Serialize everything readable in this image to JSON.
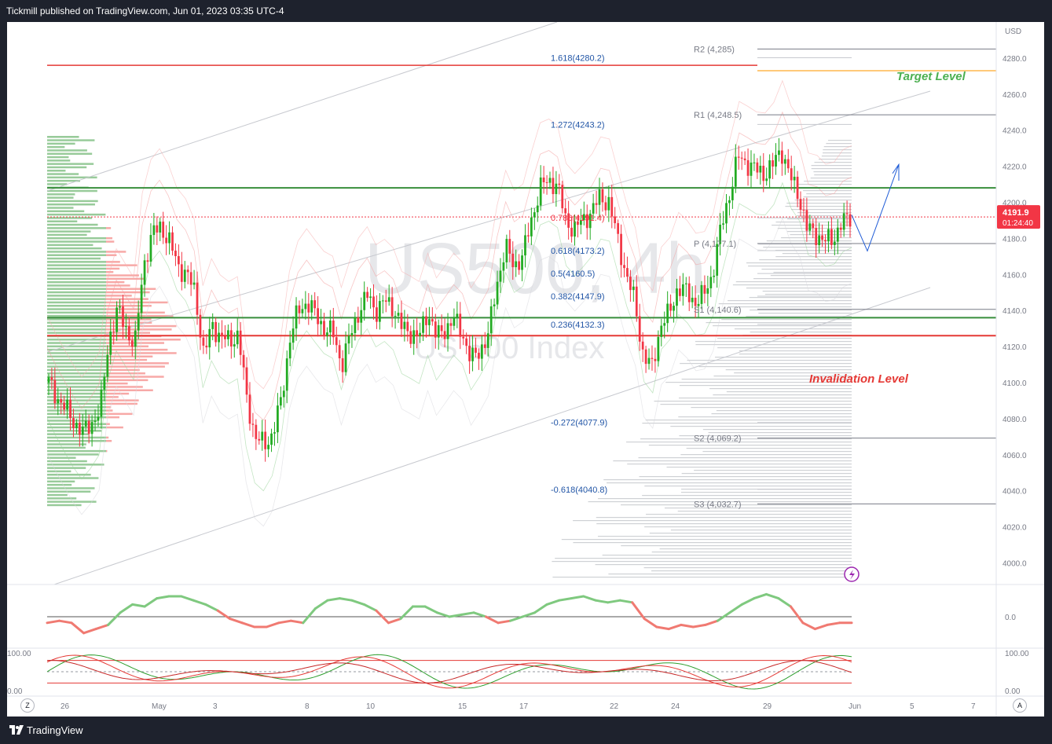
{
  "header": {
    "published": "Tickmill published on TradingView.com, Jun 01, 2023 03:35 UTC-4"
  },
  "footer": {
    "brand": "TradingView",
    "logo_icon": "tradingview-logo-icon"
  },
  "buttons": {
    "left_corner": "Z",
    "right_corner": "A"
  },
  "colors": {
    "up": "#22ab22",
    "down": "#f23645",
    "fib_text": "#2155a6",
    "green_line": "#388e3c",
    "red_line": "#e53935",
    "target_text": "#4caf50",
    "invalid_text": "#e53935",
    "pivot_text": "#787b86",
    "orange": "#ffb74d",
    "forecast": "#1e5bd6",
    "price_badge": "#f23645"
  },
  "chart_data": [
    {
      "type": "candlestick",
      "title": "",
      "watermark": {
        "symbol": "US500, 4h",
        "name": "US 500 Index"
      },
      "currency": "USD",
      "ylim": [
        3988,
        4300
      ],
      "y_ticks": [
        "4280.0",
        "4260.0",
        "4240.0",
        "4220.0",
        "4200.0",
        "4180.0",
        "4160.0",
        "4140.0",
        "4120.0",
        "4100.0",
        "4080.0",
        "4060.0",
        "4040.0",
        "4020.0",
        "4000.0"
      ],
      "x_ticks": [
        "26",
        "May",
        "3",
        "8",
        "10",
        "15",
        "17",
        "22",
        "24",
        "29",
        "Jun",
        "5",
        "7"
      ],
      "close_path": [
        4100,
        4092,
        4085,
        4078,
        4072,
        4078,
        4085,
        4125,
        4140,
        4130,
        4120,
        4165,
        4182,
        4187,
        4178,
        4165,
        4160,
        4150,
        4115,
        4132,
        4125,
        4123,
        4127,
        4090,
        4070,
        4065,
        4072,
        4090,
        4125,
        4140,
        4145,
        4137,
        4130,
        4127,
        4110,
        4126,
        4140,
        4148,
        4140,
        4145,
        4142,
        4130,
        4128,
        4125,
        4140,
        4125,
        4130,
        4135,
        4128,
        4112,
        4118,
        4126,
        4155,
        4175,
        4165,
        4170,
        4190,
        4208,
        4212,
        4210,
        4190,
        4185,
        4190,
        4195,
        4203,
        4200,
        4180,
        4160,
        4145,
        4115,
        4108,
        4132,
        4138,
        4153,
        4150,
        4145,
        4148,
        4160,
        4185,
        4205,
        4225,
        4222,
        4218,
        4216,
        4220,
        4230,
        4214,
        4205,
        4185,
        4183,
        4178,
        4180,
        4188,
        4191.9
      ],
      "close_path_extent": {
        "first_date": "26",
        "last_date": "Jun"
      },
      "last_price": "4191.9",
      "countdown": "01:24:40",
      "fib_levels": [
        {
          "label": "1.618(4280.2)",
          "value": 4280.2
        },
        {
          "label": "1.272(4243.2)",
          "value": 4243.2
        },
        {
          "label": "0.786(4191.4)",
          "value": 4191.4
        },
        {
          "label": "0.618(4173.2)",
          "value": 4173.2
        },
        {
          "label": "0.5(4160.5)",
          "value": 4160.5
        },
        {
          "label": "0.382(4147.9)",
          "value": 4147.9
        },
        {
          "label": "0.236(4132.3)",
          "value": 4132.3
        },
        {
          "label": "-0.272(4077.9)",
          "value": 4077.9
        },
        {
          "label": "-0.618(4040.8)",
          "value": 4040.8
        }
      ],
      "pivots": [
        {
          "label": "R2 (4,285)",
          "value": 4285
        },
        {
          "label": "R1 (4,248.5)",
          "value": 4248.5
        },
        {
          "label": "P (4,177.1)",
          "value": 4177.1
        },
        {
          "label": "S1 (4,140.6)",
          "value": 4140.6
        },
        {
          "label": "S2 (4,069.2)",
          "value": 4069.2
        },
        {
          "label": "S3 (4,032.7)",
          "value": 4032.7
        }
      ],
      "horizontal_lines": [
        {
          "name": "red-resistance",
          "value": 4276,
          "color": "#e53935"
        },
        {
          "name": "target",
          "value": 4273,
          "color": "#ffb74d"
        },
        {
          "name": "green-upper",
          "value": 4208,
          "color": "#388e3c"
        },
        {
          "name": "green-lower",
          "value": 4136,
          "color": "#388e3c"
        },
        {
          "name": "invalidation",
          "value": 4126,
          "color": "#e53935"
        }
      ],
      "annotations": {
        "target": "Target Level",
        "invalidation": "Invalidation Level"
      }
    },
    {
      "type": "line",
      "name": "oscillator",
      "y_ticks": [
        "0.0"
      ],
      "zero_line": 0,
      "ylim": [
        -1.2,
        1.2
      ],
      "values": [
        -0.3,
        -0.2,
        -0.3,
        -0.8,
        -0.6,
        -0.4,
        0.2,
        0.6,
        0.5,
        0.9,
        1.0,
        1.0,
        0.8,
        0.6,
        0.3,
        -0.1,
        -0.3,
        -0.5,
        -0.5,
        -0.3,
        -0.2,
        -0.3,
        0.4,
        0.8,
        0.9,
        0.8,
        0.6,
        0.3,
        -0.3,
        -0.1,
        0.5,
        0.5,
        0.2,
        0.0,
        0.1,
        0.2,
        0.0,
        -0.3,
        -0.2,
        0.0,
        0.2,
        0.6,
        0.8,
        0.9,
        1.0,
        0.8,
        0.7,
        0.8,
        0.7,
        -0.1,
        -0.5,
        -0.6,
        -0.4,
        -0.5,
        -0.4,
        -0.2,
        0.2,
        0.6,
        0.9,
        1.1,
        0.9,
        0.5,
        -0.3,
        -0.6,
        -0.4,
        -0.3,
        -0.3
      ]
    },
    {
      "type": "line",
      "name": "stochastic",
      "y_ticks": [
        "100.00",
        "0.00"
      ],
      "ylim": [
        0,
        100
      ],
      "levels": [
        80,
        50,
        20
      ]
    }
  ]
}
